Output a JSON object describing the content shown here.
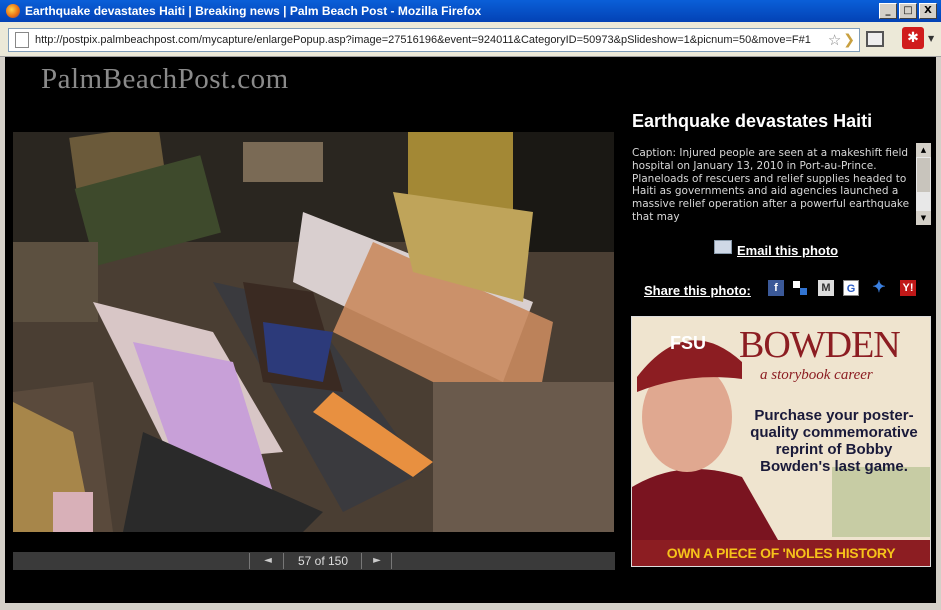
{
  "window": {
    "title": "Earthquake devastates Haiti | Breaking news | Palm Beach Post - Mozilla Firefox",
    "minimize": "_",
    "maximize": "□",
    "close": "X"
  },
  "addressbar": {
    "url": "http://postpix.palmbeachpost.com/mycapture/enlargePopup.asp?image=27516196&event=924011&CategoryID=50973&pSlideshow=1&picnum=50&move=F#1"
  },
  "site": {
    "logo": "PalmBeachPost.com"
  },
  "gallery": {
    "title": "Earthquake devastates Haiti",
    "caption": "Caption: Injured people are seen at a makeshift field hospital on January 13, 2010 in Port-au-Prince. Planeloads of rescuers and relief supplies headed to Haiti as governments and aid agencies launched a massive relief operation after a powerful earthquake that may",
    "counter": "57 of 150",
    "prev": "◄",
    "next": "►",
    "email_label": "Email this photo",
    "share_label": "Share this photo:"
  },
  "share_icons": {
    "facebook": "f",
    "delicious": "",
    "myspace": "M",
    "google": "G",
    "digg": "✦",
    "yahoo": "Y!"
  },
  "ad": {
    "cap_logo": "FSU",
    "title": "BOWDEN",
    "subtitle": "a storybook career",
    "body": "Purchase your poster-quality commemorative reprint of Bobby Bowden's last game.",
    "bottom": "OWN A PIECE OF 'NOLES HISTORY",
    "brand_color": "#8c1d22",
    "accent_color": "#f6c21a"
  }
}
